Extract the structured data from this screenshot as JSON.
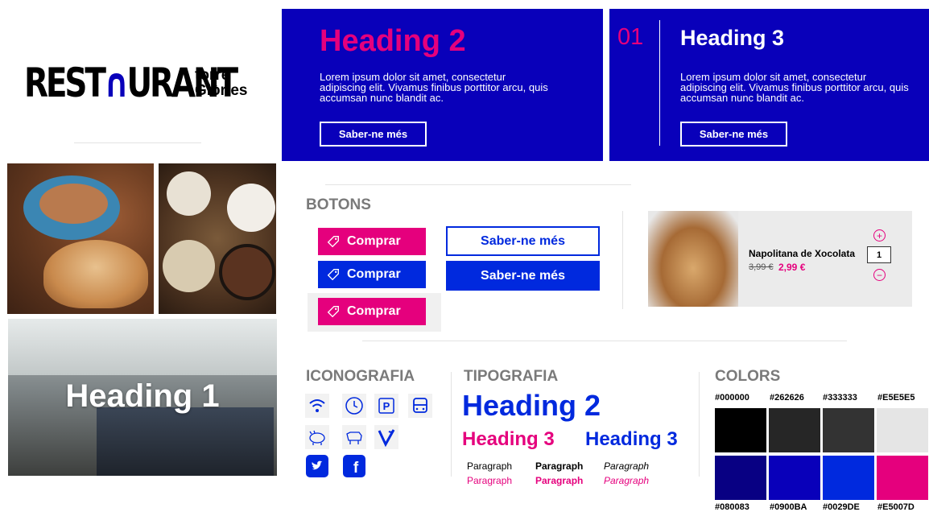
{
  "logo": {
    "main_pre": "REST",
    "main_a": "∩",
    "main_post": "URANT",
    "sub_line1": "torre",
    "sub_line2": "Glòries"
  },
  "hero1": {
    "heading": "Heading 2",
    "text": "Lorem ipsum dolor sit amet, consectetur adipiscing elit. Vivamus finibus porttitor arcu, quis accumsan nunc blandit ac.",
    "button": "Saber-ne més"
  },
  "hero2": {
    "number": "01",
    "heading": "Heading 3",
    "text": "Lorem ipsum dolor sit amet, consectetur adipiscing elit. Vivamus finibus porttitor arcu, quis accumsan nunc blandit ac.",
    "button": "Saber-ne més"
  },
  "photos": {
    "heading1": "Heading 1"
  },
  "botons": {
    "title": "BOTONS",
    "comprar": "Comprar",
    "saber": "Saber-ne més"
  },
  "product": {
    "name": "Napolitana de Xocolata",
    "old_price": "3,99 €",
    "new_price": "2,99 €",
    "qty": "1",
    "plus": "+",
    "minus": "−"
  },
  "iconografia": {
    "title": "ICONOGRAFIA",
    "icons": [
      "wifi-icon",
      "clock-icon",
      "parking-icon",
      "bus-icon",
      "pig-icon",
      "cow-icon",
      "vegan-icon",
      "twitter-icon",
      "facebook-icon"
    ]
  },
  "tipografia": {
    "title": "TIPOGRAFIA",
    "h2": "Heading 2",
    "h3_pink": "Heading 3",
    "h3_blue": "Heading 3",
    "paragraph": "Paragraph"
  },
  "colors": {
    "title": "COLORS",
    "swatches": [
      {
        "hex": "#000000"
      },
      {
        "hex": "#262626"
      },
      {
        "hex": "#333333"
      },
      {
        "hex": "#E5E5E5"
      },
      {
        "hex": "#080083"
      },
      {
        "hex": "#0900BA"
      },
      {
        "hex": "#0029DE"
      },
      {
        "hex": "#E5007D"
      }
    ]
  }
}
